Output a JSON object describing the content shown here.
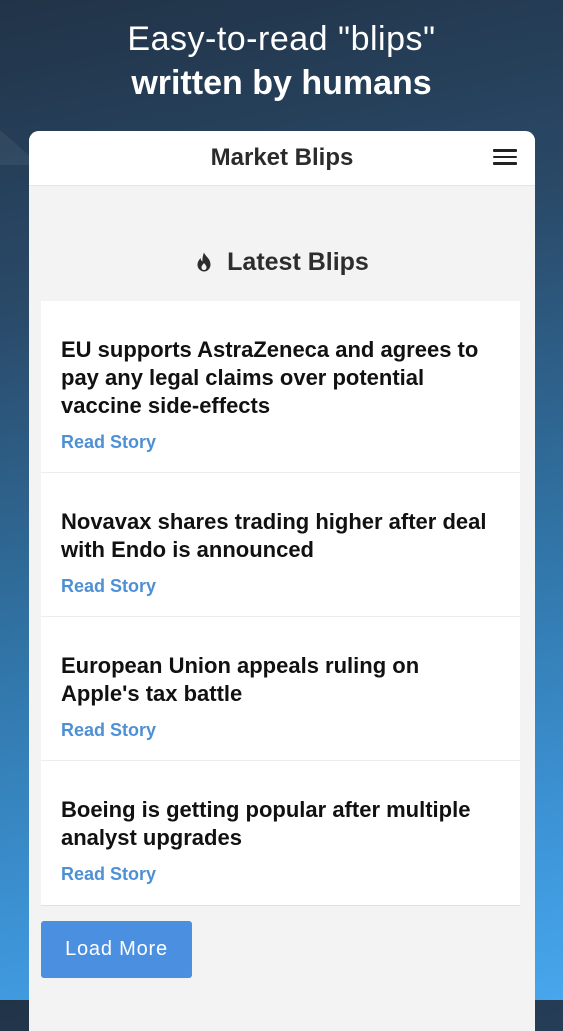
{
  "promo": {
    "line1": "Easy-to-read \"blips\"",
    "line2": "written by humans"
  },
  "app": {
    "title": "Market Blips",
    "menu_icon": "hamburger-menu-icon"
  },
  "feed": {
    "heading": "Latest Blips",
    "heading_icon": "flame-icon",
    "items": [
      {
        "title": "EU supports AstraZeneca and agrees to pay any legal claims over potential vaccine side-effects",
        "link_label": "Read Story"
      },
      {
        "title": "Novavax shares trading higher after deal with Endo is announced",
        "link_label": "Read Story"
      },
      {
        "title": "European Union appeals ruling on Apple's tax battle",
        "link_label": "Read Story"
      },
      {
        "title": "Boeing is getting popular after multiple analyst upgrades",
        "link_label": "Read Story"
      }
    ],
    "load_more_label": "Load More"
  },
  "colors": {
    "accent": "#4a8fe0",
    "link": "#4f90d4",
    "background_top": "#213347",
    "background_bottom": "#48a6ec"
  }
}
